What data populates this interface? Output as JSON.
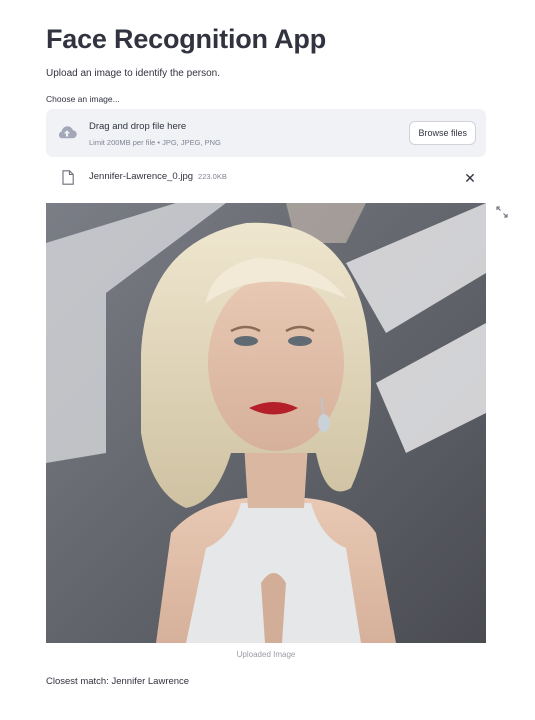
{
  "app": {
    "title": "Face Recognition App",
    "subtitle": "Upload an image to identify the person."
  },
  "uploader": {
    "label": "Choose an image...",
    "drop_text": "Drag and drop file here",
    "limit_text": "Limit 200MB per file • JPG, JPEG, PNG",
    "browse_label": "Browse files",
    "icon": "cloud-upload-icon"
  },
  "uploaded_file": {
    "name": "Jennifer-Lawrence_0.jpg",
    "size": "223.0KB",
    "icon": "file-icon",
    "close_glyph": "✕"
  },
  "image": {
    "caption": "Uploaded Image"
  },
  "result": {
    "text": "Closest match: Jennifer Lawrence"
  },
  "colors": {
    "text": "#31333f",
    "muted": "#808495",
    "dropzone_bg": "#f0f2f6"
  }
}
